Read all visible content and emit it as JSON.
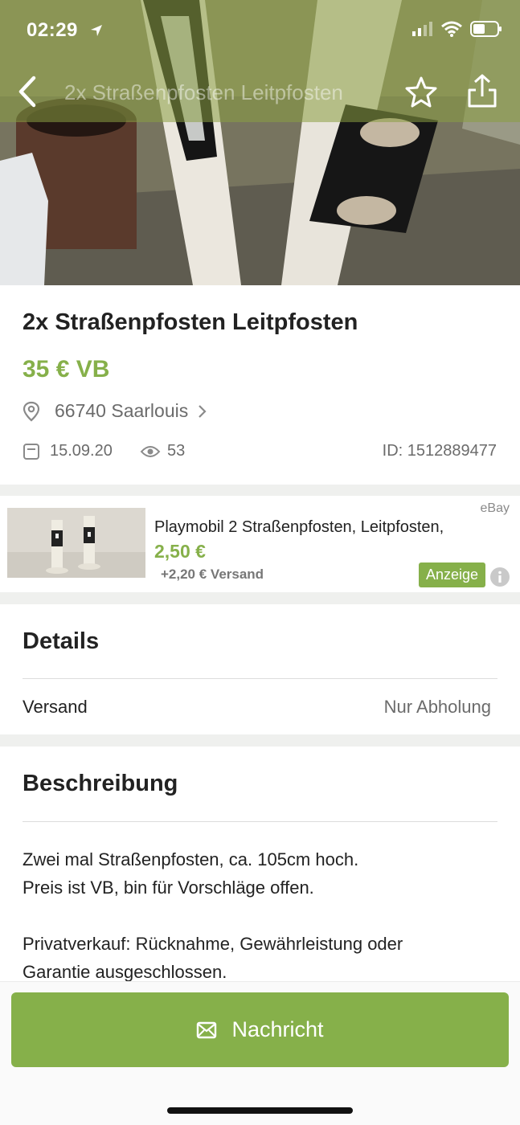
{
  "status_bar": {
    "time": "02:29",
    "icons": [
      "location-arrow-icon",
      "signal-icon",
      "wifi-icon",
      "battery-icon"
    ]
  },
  "nav": {
    "title": "2x Straßenpfosten Leitpfosten",
    "icons": [
      "back-icon",
      "star-icon",
      "share-icon"
    ]
  },
  "listing": {
    "title": "2x Straßenpfosten Leitpfosten",
    "price": "35 € VB",
    "location": "66740 Saarlouis",
    "date": "15.09.20",
    "views": "53",
    "id": "ID: 1512889477"
  },
  "ad": {
    "source": "eBay",
    "title": "Playmobil 2 Straßenpfosten, Leitpfosten,",
    "price": "2,50 €",
    "shipping": "+2,20 € Versand",
    "badge": "Anzeige"
  },
  "details": {
    "heading": "Details",
    "rows": [
      {
        "label": "Versand",
        "value": "Nur Abholung"
      }
    ]
  },
  "description": {
    "heading": "Beschreibung",
    "lines": [
      "Zwei mal Straßenpfosten, ca. 105cm hoch.",
      "Preis ist VB, bin für Vorschläge offen.",
      "Privatverkauf: Rücknahme, Gewährleistung oder",
      "Garantie ausgeschlossen."
    ]
  },
  "action": {
    "message_label": "Nachricht"
  },
  "colors": {
    "accent": "#86b04a",
    "nav_overlay": "#8a9e42"
  }
}
